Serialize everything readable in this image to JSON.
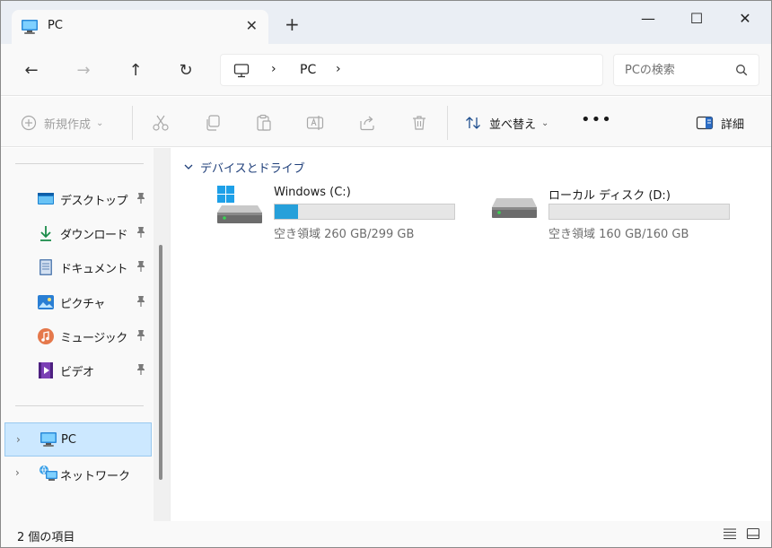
{
  "window": {
    "tab_title": "PC",
    "tab_close": "✕",
    "new_tab": "+",
    "minimize": "—",
    "maximize": "☐",
    "close": "✕"
  },
  "nav": {
    "back": "←",
    "forward": "→",
    "up": "↑",
    "refresh": "↻"
  },
  "address": {
    "separator": "›",
    "path": "PC"
  },
  "search": {
    "placeholder": "PCの検索"
  },
  "commands": {
    "new_label": "新規作成",
    "caret": "⌄",
    "sort_label": "並べ替え",
    "more": "•••",
    "details_label": "詳細"
  },
  "sidebar": {
    "quick_access": [
      {
        "label": "デスクトップ",
        "icon": "desktop-icon"
      },
      {
        "label": "ダウンロード",
        "icon": "download-icon"
      },
      {
        "label": "ドキュメント",
        "icon": "documents-icon"
      },
      {
        "label": "ピクチャ",
        "icon": "pictures-icon"
      },
      {
        "label": "ミュージック",
        "icon": "music-icon"
      },
      {
        "label": "ビデオ",
        "icon": "video-icon"
      }
    ],
    "tree": [
      {
        "label": "PC",
        "icon": "pc-icon",
        "selected": true
      },
      {
        "label": "ネットワーク",
        "icon": "network-icon",
        "selected": false
      }
    ],
    "chevron": "›"
  },
  "content": {
    "group_title": "デバイスとドライブ",
    "drives": [
      {
        "name": "Windows (C:)",
        "space": "空き領域 260 GB/299 GB",
        "used_fraction": 0.13,
        "icon": "windows-drive-icon"
      },
      {
        "name": "ローカル ディスク (D:)",
        "space": "空き領域 160 GB/160 GB",
        "used_fraction": 0.0,
        "icon": "drive-icon"
      }
    ]
  },
  "status": {
    "item_count": "2 個の項目"
  },
  "colors": {
    "accent": "#26a0da",
    "selection": "#cce8ff"
  }
}
